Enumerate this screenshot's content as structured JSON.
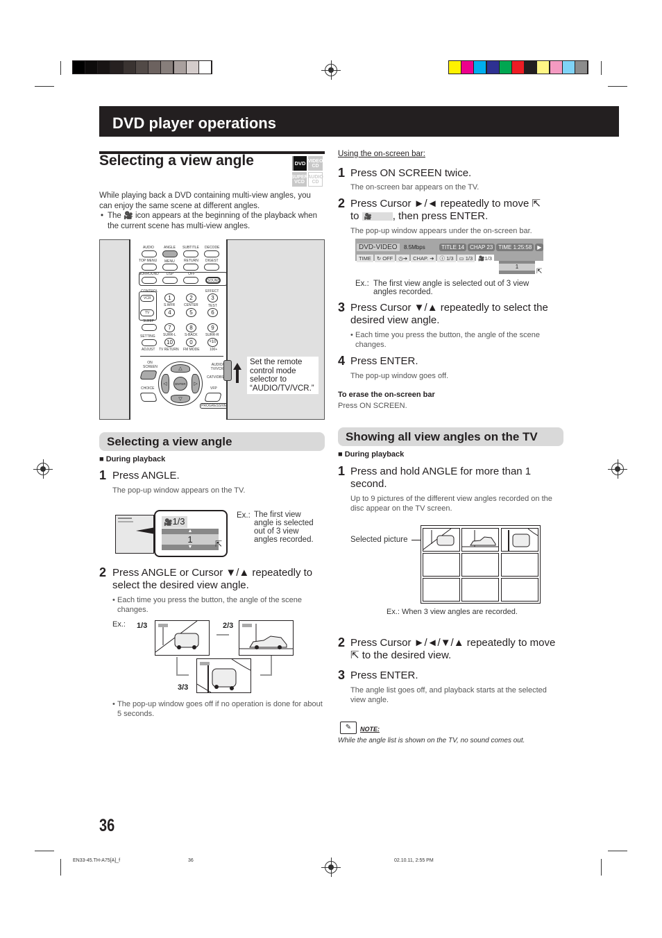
{
  "color_bars": {
    "grayscale": [
      "#000000",
      "#0d0b0b",
      "#181414",
      "#262020",
      "#3a3331",
      "#524a47",
      "#6c625f",
      "#877e7b",
      "#a9a09e",
      "#d4cccb",
      "#ffffff"
    ],
    "process": [
      "#fff200",
      "#ec008c",
      "#00aeef",
      "#2e3192",
      "#00a651",
      "#ed1c24",
      "#231f20",
      "#fff685",
      "#f49ac1",
      "#7fd3f7",
      "#8c8c8c"
    ]
  },
  "banner": {
    "title": "DVD player operations"
  },
  "section_left": {
    "title": "Selecting a view angle",
    "disc_badges": [
      "DVD",
      "VIDEO CD",
      "SUPER VCD",
      "AUDIO CD"
    ],
    "intro": "While playing back a DVD containing multi-view angles, you can enjoy the same scene at different angles.",
    "bullet_pre": "The",
    "bullet_post": "icon appears at the beginning of the playback when the current scene has multi-view angles.",
    "remote_callout": "Set the remote control mode selector to “AUDIO/TV/VCR.”",
    "remote": {
      "row1": [
        "AUDIO",
        "ANGLE",
        "SUBTITLE",
        "DECODE"
      ],
      "row2": [
        "TOP MENU",
        "MENU",
        "RETURN",
        "DIGEST"
      ],
      "row3": [
        "SURROUND",
        "DSP",
        "OFF",
        "SOUND"
      ],
      "control": "CONTROL",
      "effect": "EFFECT",
      "vcr": "VCR",
      "tv": "TV",
      "sleep": "SLEEP",
      "setting": "SETTING",
      "adjust": "ADJUST",
      "numbers": [
        "1",
        "2",
        "3",
        "4",
        "5",
        "6",
        "7",
        "8",
        "9",
        "10",
        "0",
        "+10"
      ],
      "num_labels": [
        "S.WFR",
        "CENTER",
        "TEST",
        "SURR-L",
        "S-BACK",
        "SURR-R",
        "TV RETURN",
        "FM MODE",
        "100+"
      ],
      "on_screen": "ON SCREEN",
      "enter": "ENTER",
      "choice": "CHOICE",
      "vfp": "VFP",
      "progressive": "PROGRESSIVE",
      "selector_top": "AUDIO/ TV/VCR",
      "selector_bottom": "CATV/DBS"
    }
  },
  "subsection_left": {
    "title": "Selecting a view angle",
    "during": "During playback",
    "steps": [
      {
        "num": "1",
        "text": "Press ANGLE.",
        "desc": "The pop-up window appears on the TV.",
        "popup_value": "1/3",
        "popup_selected": "1",
        "example_label": "Ex.:",
        "example_text": "The first view angle is selected out of 3 view angles recorded."
      },
      {
        "num": "2",
        "text": "Press ANGLE or Cursor ▼/▲ repeatedly to select the desired view angle.",
        "bullet": "Each time you press the button, the angle of the scene changes.",
        "example_label": "Ex.:",
        "angles": [
          "1/3",
          "2/3",
          "3/3"
        ],
        "bullet2": "The pop-up window goes off if no operation is done for about 5 seconds."
      }
    ]
  },
  "section_right": {
    "using_label": "Using the on-screen bar:",
    "steps": [
      {
        "num": "1",
        "text": "Press ON SCREEN twice.",
        "desc": "The on-screen bar appears on the TV."
      },
      {
        "num": "2",
        "text_a": "Press Cursor ►/◄ repeatedly to move",
        "text_b": "to",
        "text_c": ", then press ENTER.",
        "desc": "The pop-up window appears under the on-screen bar."
      },
      {
        "num": "3",
        "text": "Press Cursor ▼/▲ repeatedly to select the desired view angle.",
        "bullet": "Each time you press the button, the angle of the scene changes."
      },
      {
        "num": "4",
        "text": "Press ENTER.",
        "desc": "The pop-up window goes off."
      }
    ],
    "osd": {
      "mode": "DVD-VIDEO",
      "bitrate": "8.5Mbps",
      "title": "TITLE 14",
      "chapter": "CHAP 23",
      "time": "TIME 1:25:58",
      "row2": [
        "TIME",
        "OFF",
        "CHAP.",
        "1/3",
        "1/3",
        "1/3"
      ],
      "popup_selected": "1"
    },
    "example_label": "Ex.:",
    "example_text": "The first view angle is selected out of 3 view angles recorded.",
    "erase_title": "To erase the on-screen bar",
    "erase_text": "Press ON SCREEN."
  },
  "subsection_right": {
    "title": "Showing all view angles on the TV",
    "during": "During playback",
    "steps": [
      {
        "num": "1",
        "text": "Press and hold ANGLE for more than 1 second.",
        "desc": "Up to 9 pictures of the different view angles recorded on the disc appear on the TV screen."
      },
      {
        "num": "2",
        "text_a": "Press Cursor ►/◄/▼/▲ repeatedly to move",
        "text_b": "to the desired view."
      },
      {
        "num": "3",
        "text": "Press ENTER.",
        "desc": "The angle list goes off, and playback starts at the selected view angle."
      }
    ],
    "selected_label": "Selected picture",
    "grid_caption": "Ex.: When 3 view angles are recorded.",
    "note_title": "NOTE:",
    "note_text": "While the angle list is shown on the TV, no sound comes out."
  },
  "page_number": "36",
  "footer": {
    "file": "EN33-45.TH-A75[A]_f",
    "page": "36",
    "datetime": "02.10.11, 2:55 PM"
  }
}
